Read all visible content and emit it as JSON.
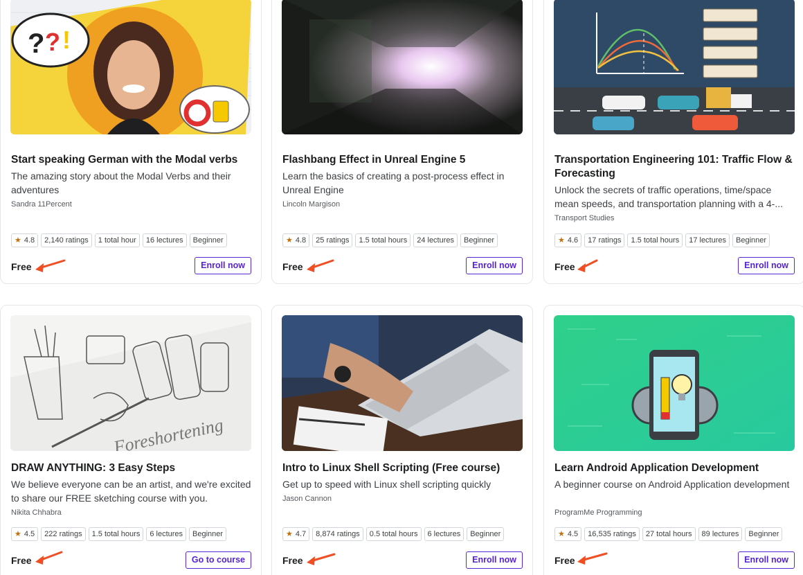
{
  "courses": [
    {
      "title": "Start speaking German with the Modal verbs",
      "description": "The amazing story about the Modal Verbs and their adventures",
      "author": "Sandra 11Percent",
      "rating": "4.8",
      "ratings": "2,140 ratings",
      "hours": "1 total hour",
      "lectures": "16 lectures",
      "level": "Beginner",
      "price": "Free",
      "button": "Enroll now"
    },
    {
      "title": "Flashbang Effect in Unreal Engine 5",
      "description": "Learn the basics of creating a post-process effect in Unreal Engine",
      "author": "Lincoln Margison",
      "rating": "4.8",
      "ratings": "25 ratings",
      "hours": "1.5 total hours",
      "lectures": "24 lectures",
      "level": "Beginner",
      "price": "Free",
      "button": "Enroll now"
    },
    {
      "title": "Transportation Engineering 101: Traffic Flow & Forecasting",
      "description": "Unlock the secrets of traffic operations, time/space mean speeds, and transportation planning with a 4-...",
      "author": "Transport Studies",
      "rating": "4.6",
      "ratings": "17 ratings",
      "hours": "1.5 total hours",
      "lectures": "17 lectures",
      "level": "Beginner",
      "price": "Free",
      "button": "Enroll now"
    },
    {
      "title": "DRAW ANYTHING: 3 Easy Steps",
      "description": "We believe everyone can be an artist, and we're excited to share our FREE sketching course with you.",
      "author": "Nikita Chhabra",
      "rating": "4.5",
      "ratings": "222 ratings",
      "hours": "1.5 total hours",
      "lectures": "6 lectures",
      "level": "Beginner",
      "price": "Free",
      "button": "Go to course"
    },
    {
      "title": "Intro to Linux Shell Scripting (Free course)",
      "description": "Get up to speed with Linux shell scripting quickly",
      "author": "Jason Cannon",
      "rating": "4.7",
      "ratings": "8,874 ratings",
      "hours": "0.5 total hours",
      "lectures": "6 lectures",
      "level": "Beginner",
      "price": "Free",
      "button": "Enroll now"
    },
    {
      "title": "Learn Android Application Development",
      "description": "A beginner course on Android Application development",
      "author": "ProgramMe Programming",
      "rating": "4.5",
      "ratings": "16,535 ratings",
      "hours": "27 total hours",
      "lectures": "89 lectures",
      "level": "Beginner",
      "price": "Free",
      "button": "Enroll now"
    }
  ],
  "colors": {
    "accent": "#5624d0",
    "star": "#c4710d",
    "arrow": "#f04e23"
  },
  "icons": {
    "star": "star-icon",
    "arrow": "red-arrow-annotation-icon"
  }
}
